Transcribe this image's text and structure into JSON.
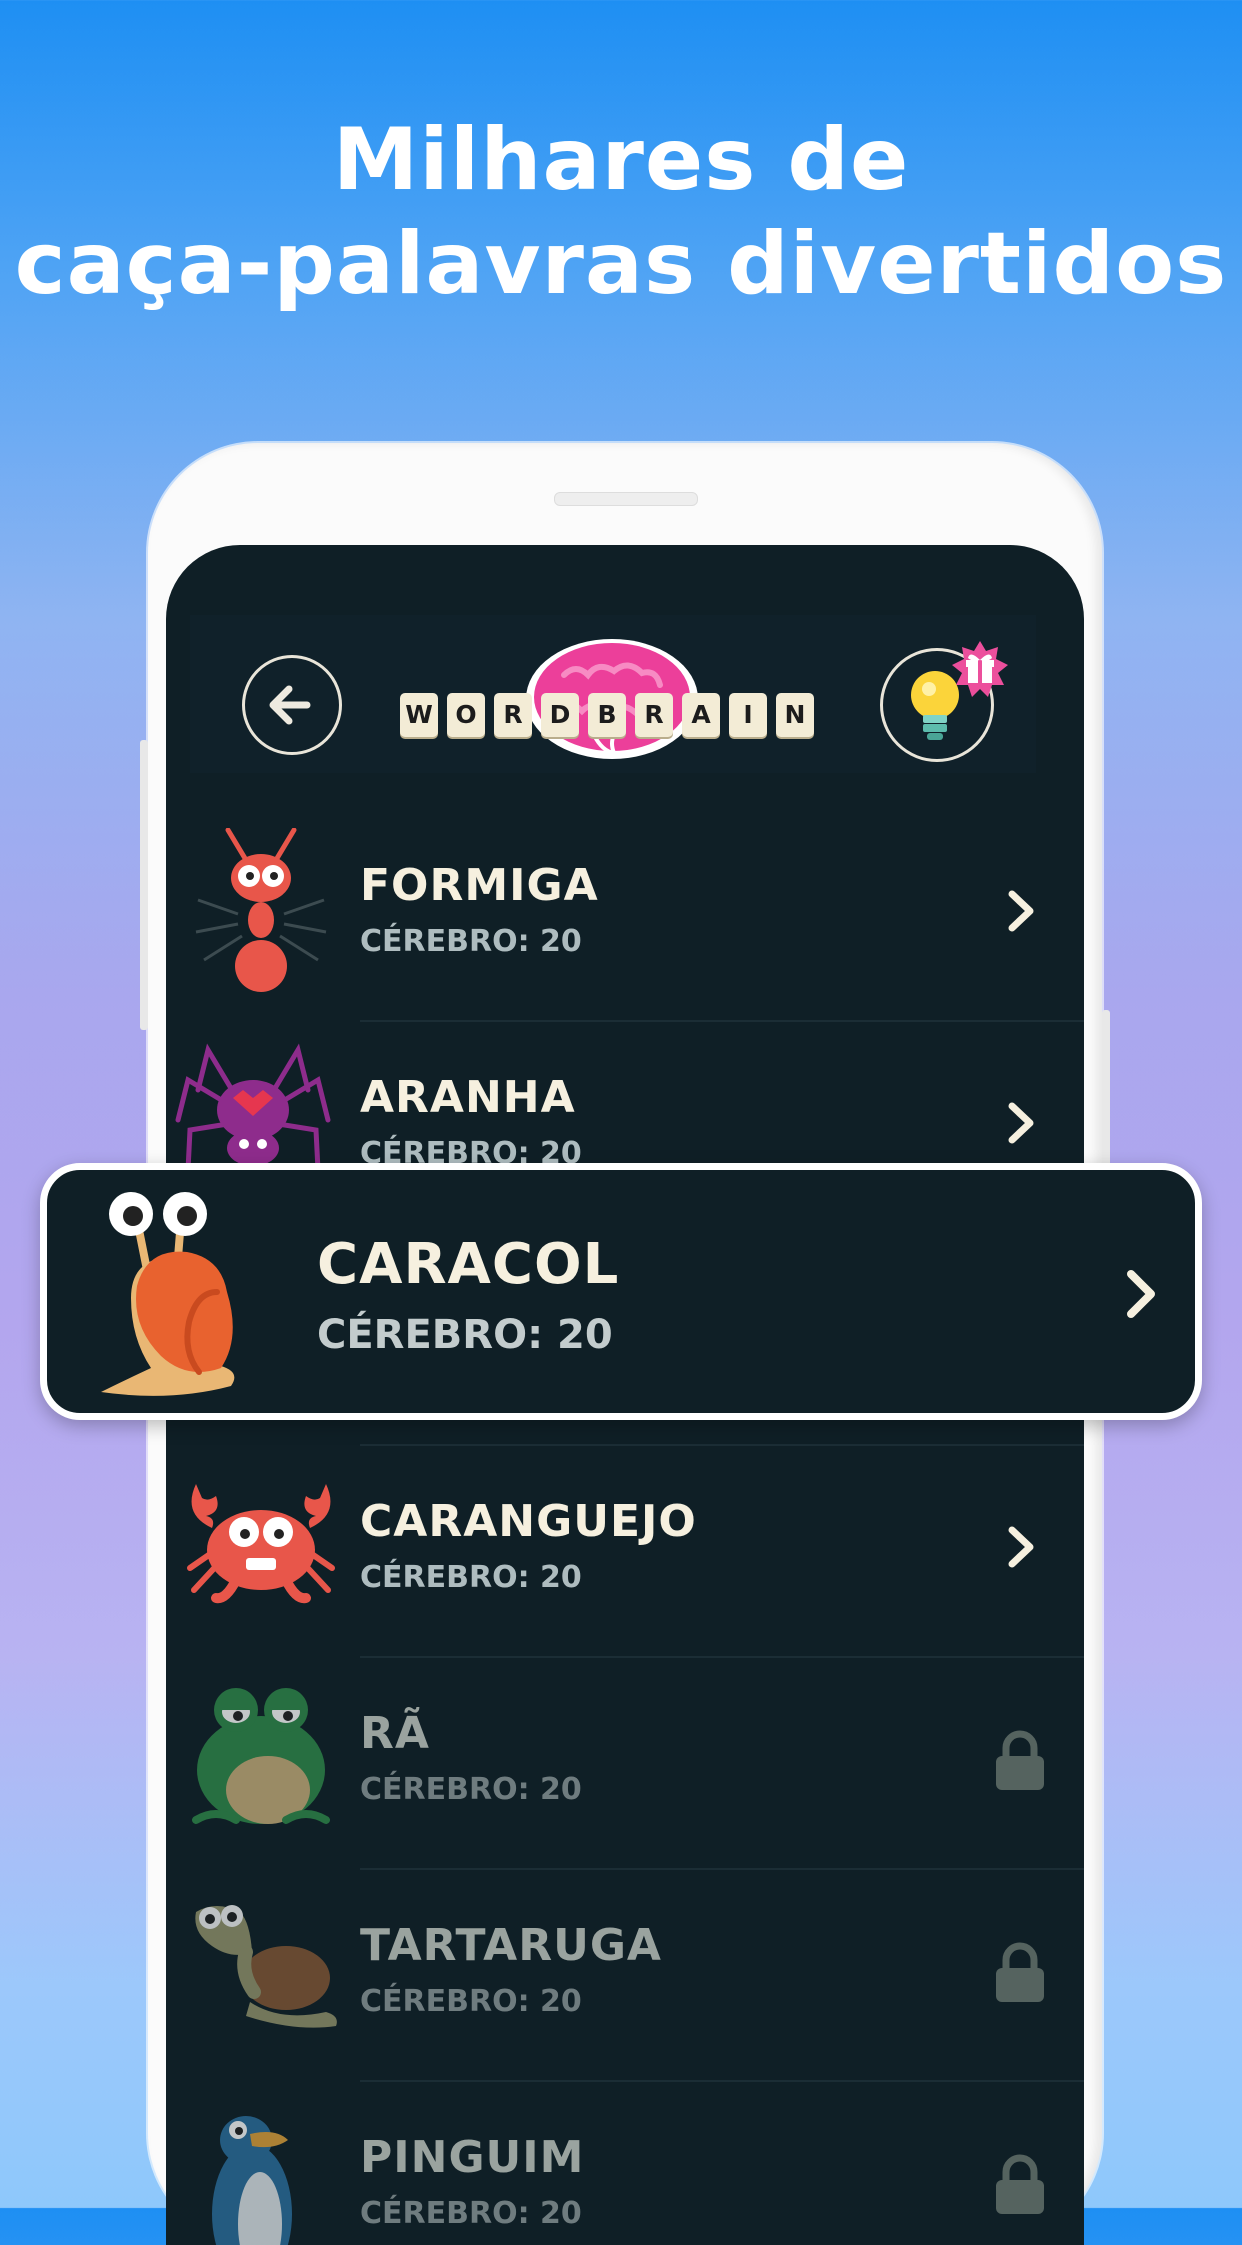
{
  "headline": {
    "line1": "Milhares de",
    "line2": "caça-palavras divertidos"
  },
  "app": {
    "logo_letters": [
      "W",
      "O",
      "R",
      "D",
      "B",
      "R",
      "A",
      "I",
      "N"
    ],
    "back_icon": "arrow-left-icon",
    "hint_icon": "lightbulb-icon",
    "gift_icon": "gift-icon"
  },
  "levels": [
    {
      "name": "FORMIGA",
      "brain": "CÉREBRO: 20",
      "icon": "ant-icon",
      "locked": false
    },
    {
      "name": "ARANHA",
      "brain": "CÉREBRO: 20",
      "icon": "spider-icon",
      "locked": false
    },
    {
      "name": "CARACOL",
      "brain": "CÉREBRO: 20",
      "icon": "snail-icon",
      "locked": false,
      "highlighted": true
    },
    {
      "name": "CARANGUEJO",
      "brain": "CÉREBRO: 20",
      "icon": "crab-icon",
      "locked": false
    },
    {
      "name": "RÃ",
      "brain": "CÉREBRO: 20",
      "icon": "frog-icon",
      "locked": true
    },
    {
      "name": "TARTARUGA",
      "brain": "CÉREBRO: 20",
      "icon": "turtle-icon",
      "locked": true
    },
    {
      "name": "PINGUIM",
      "brain": "CÉREBRO: 20",
      "icon": "penguin-icon",
      "locked": true
    }
  ],
  "colors": {
    "screen_bg": "#0f1f26",
    "title_text": "#f6f0df",
    "brain_pink": "#ec3f9a",
    "tile": "#f3ecd6"
  }
}
